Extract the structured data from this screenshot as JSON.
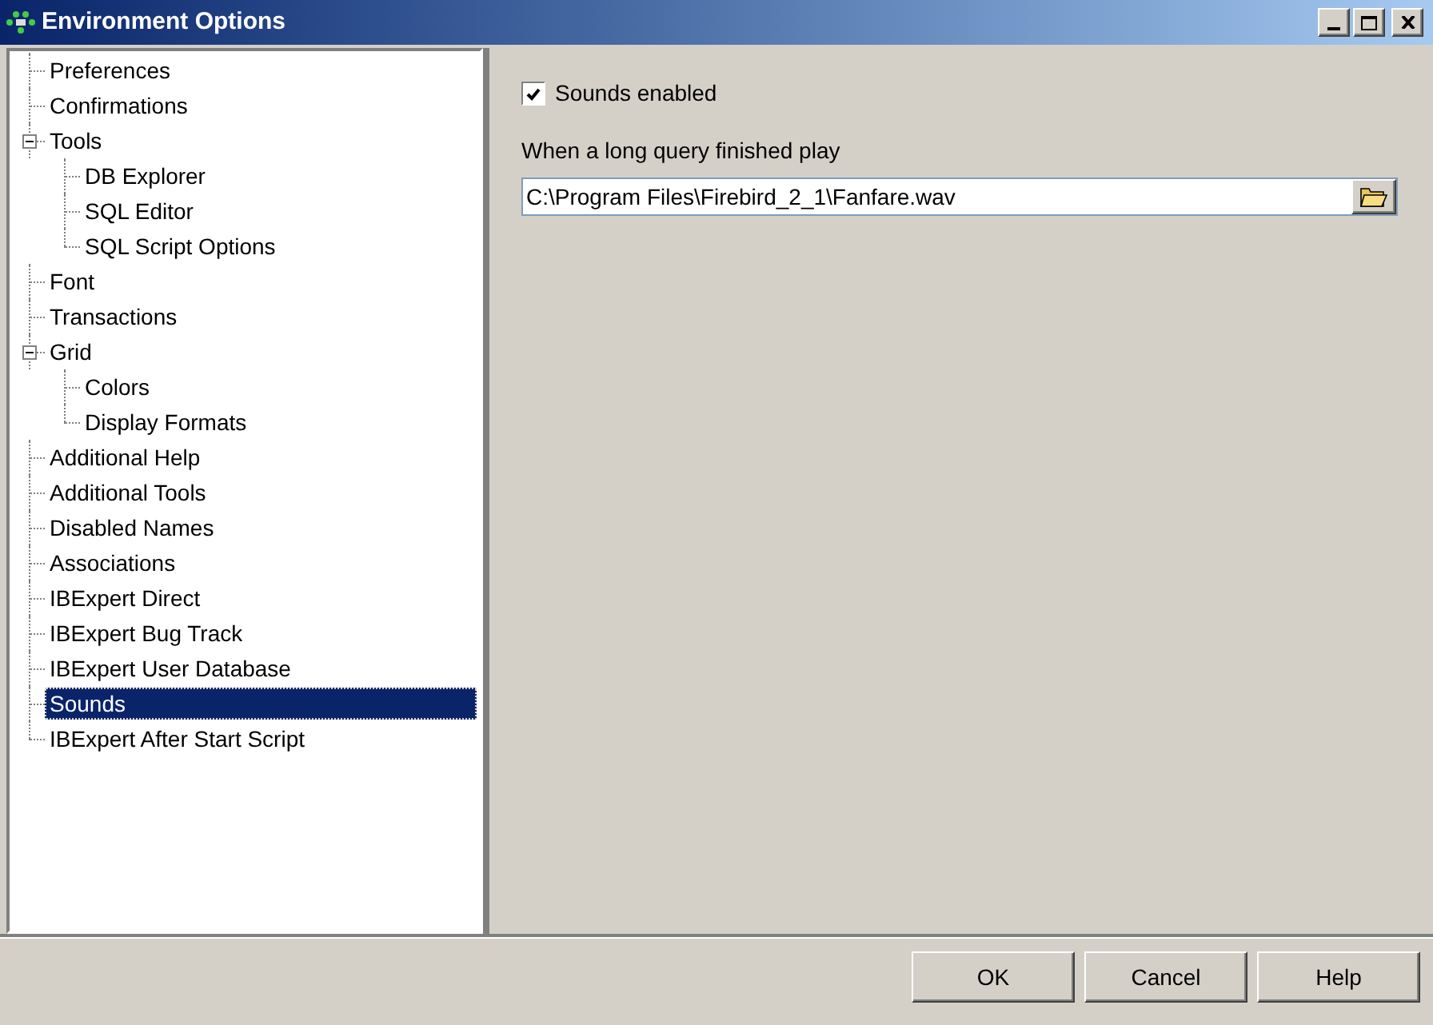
{
  "window": {
    "title": "Environment Options"
  },
  "tree": [
    {
      "label": "Preferences",
      "selected": false
    },
    {
      "label": "Confirmations",
      "selected": false
    },
    {
      "label": "Tools",
      "selected": false,
      "expanded": true,
      "children": [
        {
          "label": "DB Explorer",
          "selected": false
        },
        {
          "label": "SQL Editor",
          "selected": false
        },
        {
          "label": "SQL Script Options",
          "selected": false
        }
      ]
    },
    {
      "label": "Font",
      "selected": false
    },
    {
      "label": "Transactions",
      "selected": false
    },
    {
      "label": "Grid",
      "selected": false,
      "expanded": true,
      "children": [
        {
          "label": "Colors",
          "selected": false
        },
        {
          "label": "Display Formats",
          "selected": false
        }
      ]
    },
    {
      "label": "Additional Help",
      "selected": false
    },
    {
      "label": "Additional Tools",
      "selected": false
    },
    {
      "label": "Disabled Names",
      "selected": false
    },
    {
      "label": "Associations",
      "selected": false
    },
    {
      "label": "IBExpert Direct",
      "selected": false
    },
    {
      "label": "IBExpert Bug Track",
      "selected": false
    },
    {
      "label": "IBExpert User Database",
      "selected": false
    },
    {
      "label": "Sounds",
      "selected": true
    },
    {
      "label": "IBExpert After Start Script",
      "selected": false
    }
  ],
  "sounds_enabled": {
    "label": "Sounds enabled",
    "checked": true
  },
  "query_sound": {
    "label": "When a long query finished play",
    "value": "C:\\Program Files\\Firebird_2_1\\Fanfare.wav"
  },
  "buttons": [
    "OK",
    "Cancel",
    "Help"
  ]
}
